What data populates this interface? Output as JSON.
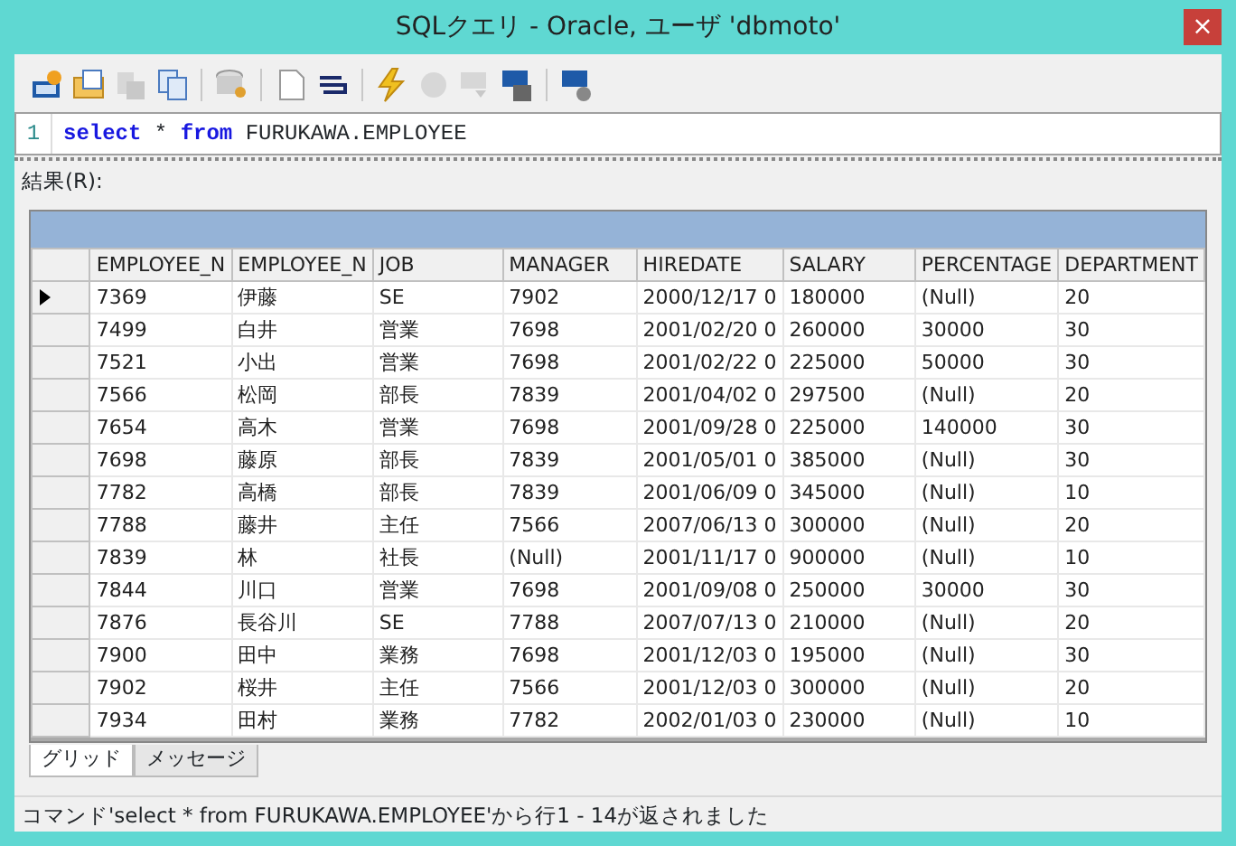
{
  "window": {
    "title": "SQLクエリ - Oracle, ユーザ 'dbmoto'",
    "close": "×"
  },
  "toolbar": [
    {
      "kind": "sql-new",
      "disabled": false
    },
    {
      "kind": "open",
      "disabled": false
    },
    {
      "kind": "save",
      "disabled": true
    },
    {
      "kind": "copy",
      "disabled": false
    },
    {
      "kind": "sep"
    },
    {
      "kind": "db-key",
      "disabled": false
    },
    {
      "kind": "sep"
    },
    {
      "kind": "doc",
      "disabled": false
    },
    {
      "kind": "wrap",
      "disabled": false
    },
    {
      "kind": "sep"
    },
    {
      "kind": "run",
      "disabled": false
    },
    {
      "kind": "stop",
      "disabled": true
    },
    {
      "kind": "sql-go",
      "disabled": true
    },
    {
      "kind": "sql-save",
      "disabled": false
    },
    {
      "kind": "sep"
    },
    {
      "kind": "sql-gear",
      "disabled": false
    }
  ],
  "editor": {
    "line_number": "1",
    "tokens": [
      {
        "text": "select",
        "kind": "keyword"
      },
      {
        "text": "*",
        "kind": "text"
      },
      {
        "text": "from",
        "kind": "keyword"
      },
      {
        "text": "FURUKAWA.EMPLOYEE",
        "kind": "text"
      }
    ]
  },
  "results_label": "結果(R):",
  "table": {
    "columns": [
      "EMPLOYEE_N",
      "EMPLOYEE_N",
      "JOB",
      "MANAGER",
      "HIREDATE",
      "SALARY",
      "PERCENTAGE",
      "DEPARTMENT"
    ],
    "rows": [
      {
        "selected": true,
        "cells": [
          "7369",
          "伊藤",
          "SE",
          "7902",
          "2000/12/17 0",
          "180000",
          "(Null)",
          "20"
        ]
      },
      {
        "selected": false,
        "cells": [
          "7499",
          "白井",
          "営業",
          "7698",
          "2001/02/20 0",
          "260000",
          "30000",
          "30"
        ]
      },
      {
        "selected": false,
        "cells": [
          "7521",
          "小出",
          "営業",
          "7698",
          "2001/02/22 0",
          "225000",
          "50000",
          "30"
        ]
      },
      {
        "selected": false,
        "cells": [
          "7566",
          "松岡",
          "部長",
          "7839",
          "2001/04/02 0",
          "297500",
          "(Null)",
          "20"
        ]
      },
      {
        "selected": false,
        "cells": [
          "7654",
          "高木",
          "営業",
          "7698",
          "2001/09/28 0",
          "225000",
          "140000",
          "30"
        ]
      },
      {
        "selected": false,
        "cells": [
          "7698",
          "藤原",
          "部長",
          "7839",
          "2001/05/01 0",
          "385000",
          "(Null)",
          "30"
        ]
      },
      {
        "selected": false,
        "cells": [
          "7782",
          "高橋",
          "部長",
          "7839",
          "2001/06/09 0",
          "345000",
          "(Null)",
          "10"
        ]
      },
      {
        "selected": false,
        "cells": [
          "7788",
          "藤井",
          "主任",
          "7566",
          "2007/06/13 0",
          "300000",
          "(Null)",
          "20"
        ]
      },
      {
        "selected": false,
        "cells": [
          "7839",
          "林",
          "社長",
          "(Null)",
          "2001/11/17 0",
          "900000",
          "(Null)",
          "10"
        ]
      },
      {
        "selected": false,
        "cells": [
          "7844",
          "川口",
          "営業",
          "7698",
          "2001/09/08 0",
          "250000",
          "30000",
          "30"
        ]
      },
      {
        "selected": false,
        "cells": [
          "7876",
          "長谷川",
          "SE",
          "7788",
          "2007/07/13 0",
          "210000",
          "(Null)",
          "20"
        ]
      },
      {
        "selected": false,
        "cells": [
          "7900",
          "田中",
          "業務",
          "7698",
          "2001/12/03 0",
          "195000",
          "(Null)",
          "30"
        ]
      },
      {
        "selected": false,
        "cells": [
          "7902",
          "桜井",
          "主任",
          "7566",
          "2001/12/03 0",
          "300000",
          "(Null)",
          "20"
        ]
      },
      {
        "selected": false,
        "cells": [
          "7934",
          "田村",
          "業務",
          "7782",
          "2002/01/03 0",
          "230000",
          "(Null)",
          "10"
        ]
      }
    ]
  },
  "tabs": [
    {
      "label": "グリッド",
      "selected": true
    },
    {
      "label": "メッセージ",
      "selected": false
    }
  ],
  "status_bar": "コマンド'select * from FURUKAWA.EMPLOYEE'から行1 - 14が返されました"
}
